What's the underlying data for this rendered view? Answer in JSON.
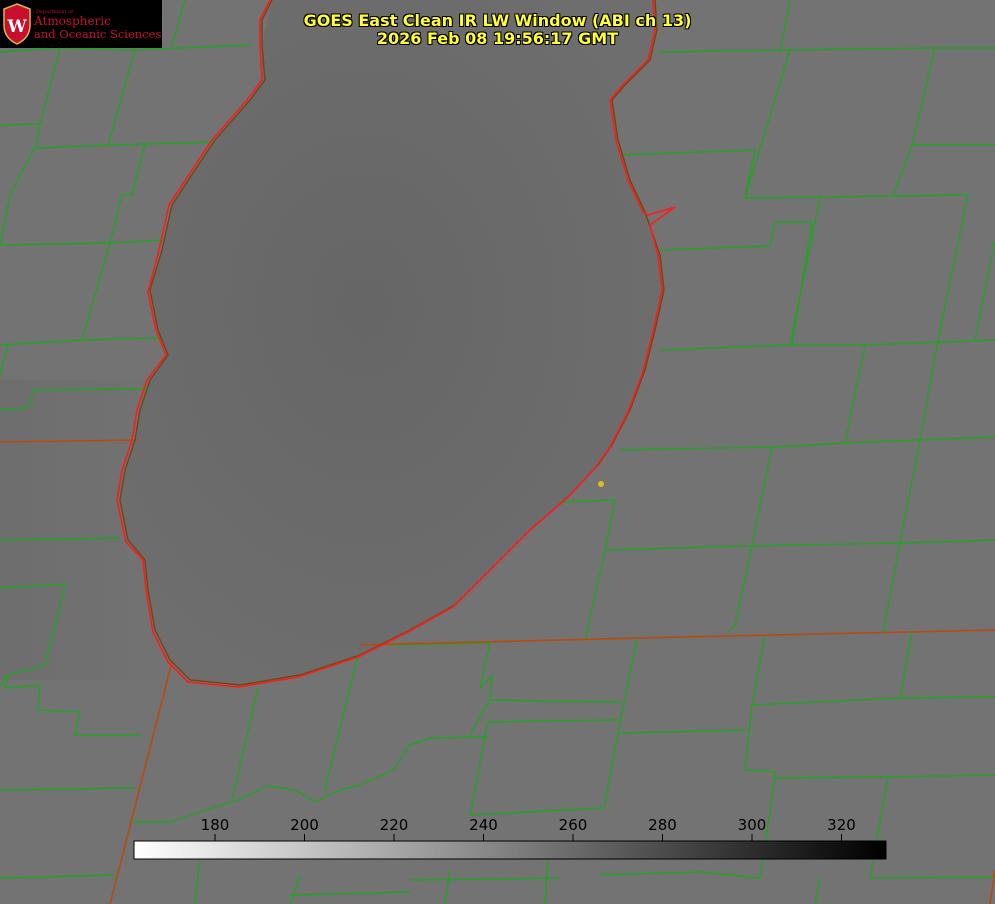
{
  "title": {
    "line1": "GOES East Clean IR LW Window (ABI ch 13)",
    "line2": "2026 Feb 08 19:56:17 GMT"
  },
  "logo": {
    "department": "Department of",
    "line1": "Atmospheric",
    "line2": "and Oceanic Sciences",
    "emblem": "uw-crest-icon"
  },
  "colorbar": {
    "ticks": [
      "180",
      "200",
      "220",
      "240",
      "260",
      "280",
      "300",
      "320"
    ],
    "colors": {
      "low": "#ffffff",
      "high": "#000000"
    }
  },
  "colors": {
    "background": "#6f6f6f",
    "county_lines": "#22a422",
    "state_lines": "#b84a12",
    "lake_outline": "#ff1a1a",
    "marker": "#d4c21a",
    "title": "#ffff33"
  }
}
